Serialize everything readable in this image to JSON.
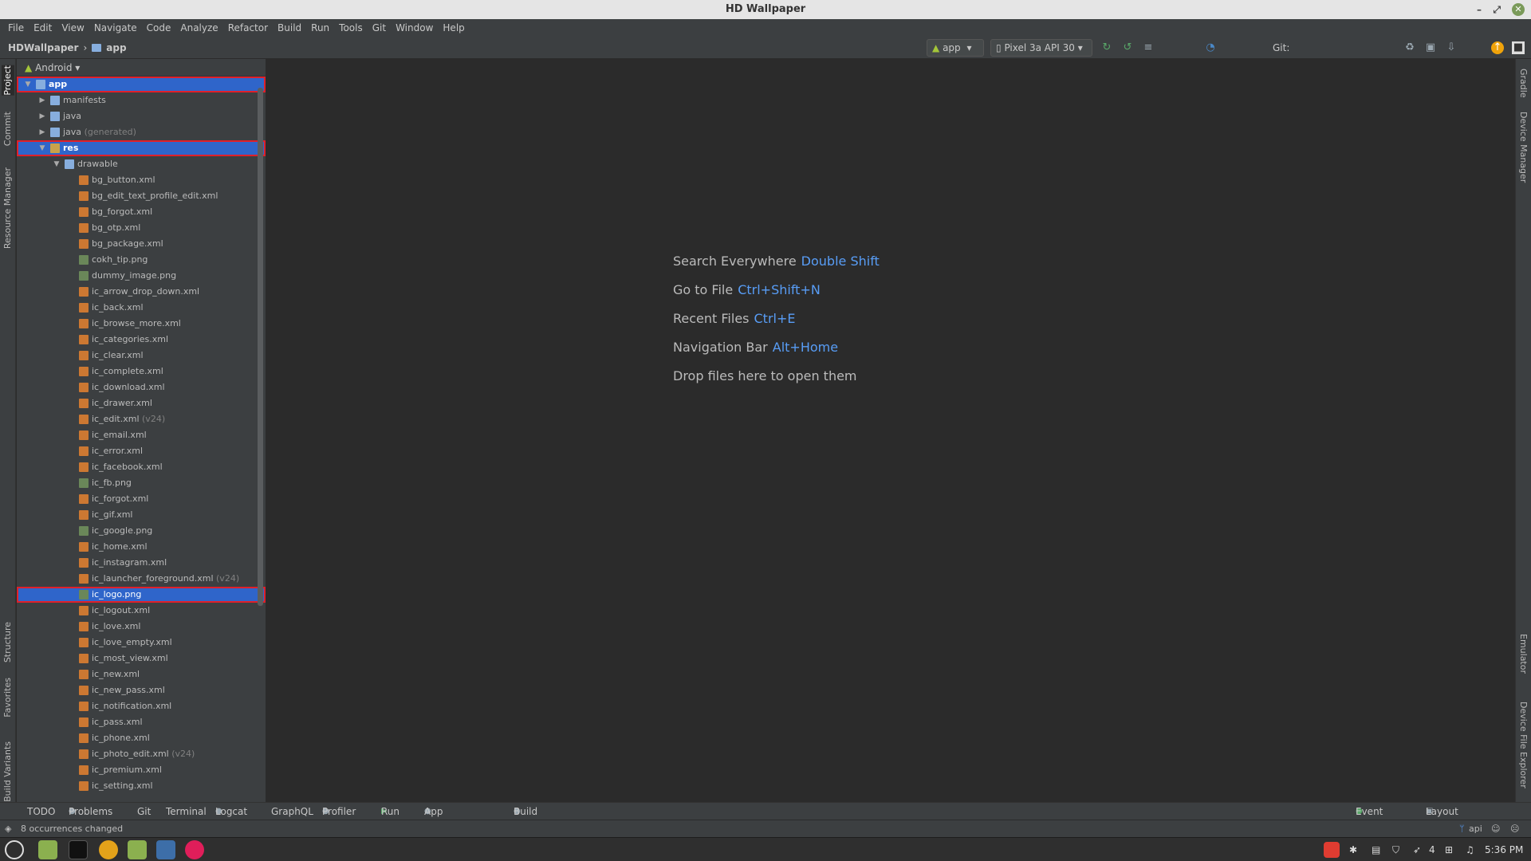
{
  "window": {
    "title": "HD Wallpaper"
  },
  "menu": [
    "File",
    "Edit",
    "View",
    "Navigate",
    "Code",
    "Analyze",
    "Refactor",
    "Build",
    "Run",
    "Tools",
    "Git",
    "Window",
    "Help"
  ],
  "breadcrumb": {
    "project": "HDWallpaper",
    "module": "app"
  },
  "toolbar": {
    "run_config": "app",
    "device": "Pixel 3a API 30",
    "git_label": "Git:"
  },
  "project_panel": {
    "view_mode": "Android"
  },
  "left_tabs": [
    "Project",
    "Commit",
    "Resource Manager",
    "Structure",
    "Favorites",
    "Build Variants"
  ],
  "right_tabs": [
    "Gradle",
    "Device Manager",
    "Emulator",
    "Device File Explorer"
  ],
  "tree": [
    {
      "label": "app",
      "type": "module",
      "indent": 0,
      "arrow": "down",
      "selected": true,
      "highlighted": true
    },
    {
      "label": "manifests",
      "type": "folder",
      "indent": 1,
      "arrow": "right"
    },
    {
      "label": "java",
      "type": "folder",
      "indent": 1,
      "arrow": "right"
    },
    {
      "label": "java",
      "suffix": "(generated)",
      "type": "folder",
      "indent": 1,
      "arrow": "right"
    },
    {
      "label": "res",
      "type": "pkg",
      "indent": 1,
      "arrow": "down",
      "selected": true,
      "highlighted": true
    },
    {
      "label": "drawable",
      "type": "folder",
      "indent": 2,
      "arrow": "down"
    },
    {
      "label": "bg_button.xml",
      "type": "xml",
      "indent": 3
    },
    {
      "label": "bg_edit_text_profile_edit.xml",
      "type": "xml",
      "indent": 3
    },
    {
      "label": "bg_forgot.xml",
      "type": "xml",
      "indent": 3
    },
    {
      "label": "bg_otp.xml",
      "type": "xml",
      "indent": 3
    },
    {
      "label": "bg_package.xml",
      "type": "xml",
      "indent": 3
    },
    {
      "label": "cokh_tip.png",
      "type": "png",
      "indent": 3
    },
    {
      "label": "dummy_image.png",
      "type": "png",
      "indent": 3
    },
    {
      "label": "ic_arrow_drop_down.xml",
      "type": "xml",
      "indent": 3
    },
    {
      "label": "ic_back.xml",
      "type": "xml",
      "indent": 3
    },
    {
      "label": "ic_browse_more.xml",
      "type": "xml",
      "indent": 3
    },
    {
      "label": "ic_categories.xml",
      "type": "xml",
      "indent": 3
    },
    {
      "label": "ic_clear.xml",
      "type": "xml",
      "indent": 3
    },
    {
      "label": "ic_complete.xml",
      "type": "xml",
      "indent": 3
    },
    {
      "label": "ic_download.xml",
      "type": "xml",
      "indent": 3
    },
    {
      "label": "ic_drawer.xml",
      "type": "xml",
      "indent": 3
    },
    {
      "label": "ic_edit.xml",
      "suffix": "(v24)",
      "type": "xml",
      "indent": 3
    },
    {
      "label": "ic_email.xml",
      "type": "xml",
      "indent": 3
    },
    {
      "label": "ic_error.xml",
      "type": "xml",
      "indent": 3
    },
    {
      "label": "ic_facebook.xml",
      "type": "xml",
      "indent": 3
    },
    {
      "label": "ic_fb.png",
      "type": "png",
      "indent": 3
    },
    {
      "label": "ic_forgot.xml",
      "type": "xml",
      "indent": 3
    },
    {
      "label": "ic_gif.xml",
      "type": "xml",
      "indent": 3
    },
    {
      "label": "ic_google.png",
      "type": "png",
      "indent": 3
    },
    {
      "label": "ic_home.xml",
      "type": "xml",
      "indent": 3
    },
    {
      "label": "ic_instagram.xml",
      "type": "xml",
      "indent": 3
    },
    {
      "label": "ic_launcher_foreground.xml",
      "suffix": "(v24)",
      "type": "xml",
      "indent": 3
    },
    {
      "label": "ic_logo.png",
      "type": "png",
      "indent": 3,
      "selected": true,
      "highlighted": true
    },
    {
      "label": "ic_logout.xml",
      "type": "xml",
      "indent": 3
    },
    {
      "label": "ic_love.xml",
      "type": "xml",
      "indent": 3
    },
    {
      "label": "ic_love_empty.xml",
      "type": "xml",
      "indent": 3
    },
    {
      "label": "ic_most_view.xml",
      "type": "xml",
      "indent": 3
    },
    {
      "label": "ic_new.xml",
      "type": "xml",
      "indent": 3
    },
    {
      "label": "ic_new_pass.xml",
      "type": "xml",
      "indent": 3
    },
    {
      "label": "ic_notification.xml",
      "type": "xml",
      "indent": 3
    },
    {
      "label": "ic_pass.xml",
      "type": "xml",
      "indent": 3
    },
    {
      "label": "ic_phone.xml",
      "type": "xml",
      "indent": 3
    },
    {
      "label": "ic_photo_edit.xml",
      "suffix": "(v24)",
      "type": "xml",
      "indent": 3
    },
    {
      "label": "ic_premium.xml",
      "type": "xml",
      "indent": 3
    },
    {
      "label": "ic_setting.xml",
      "type": "xml",
      "indent": 3
    }
  ],
  "editor_hints": [
    {
      "text": "Search Everywhere",
      "key": "Double Shift"
    },
    {
      "text": "Go to File",
      "key": "Ctrl+Shift+N"
    },
    {
      "text": "Recent Files",
      "key": "Ctrl+E"
    },
    {
      "text": "Navigation Bar",
      "key": "Alt+Home"
    },
    {
      "text": "Drop files here to open them",
      "key": ""
    }
  ],
  "bottom_tabs": [
    "TODO",
    "Problems",
    "Git",
    "Terminal",
    "Logcat",
    "GraphQL",
    "Profiler",
    "Run",
    "App Inspection",
    "Build"
  ],
  "bottom_right_tabs": [
    "Event Log",
    "Layout Inspector"
  ],
  "status": {
    "message": "8 occurrences changed",
    "branch": "api"
  },
  "taskbar": {
    "battery": "4",
    "time": "5:36 PM"
  },
  "colors": {
    "selection": "#2f65ca",
    "highlight_border": "#e0202a",
    "shortcut": "#589df6"
  }
}
